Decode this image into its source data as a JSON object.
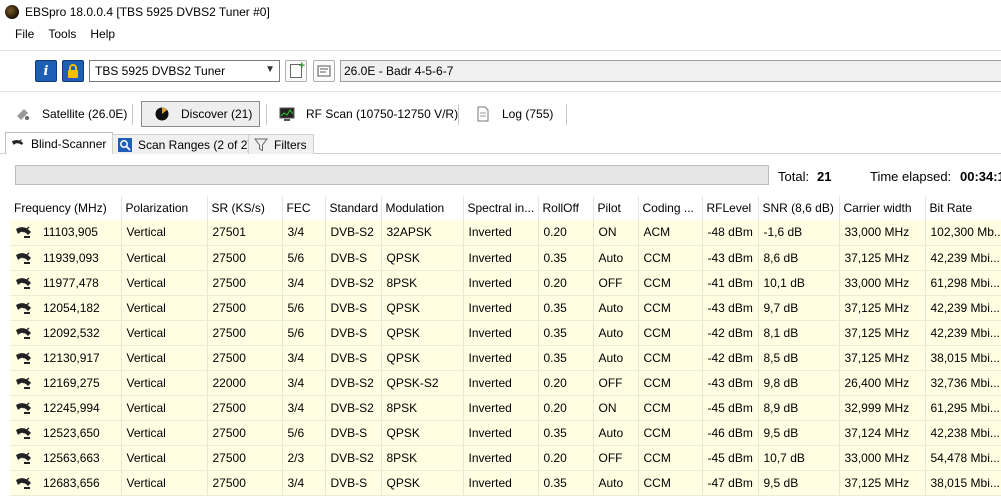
{
  "window": {
    "title": "EBSpro 18.0.0.4 [TBS 5925 DVBS2 Tuner #0]"
  },
  "menu": [
    "File",
    "Tools",
    "Help"
  ],
  "toolbar": {
    "info_icon": "info-icon",
    "lock_icon": "lock-icon",
    "tuner": "TBS 5925 DVBS2 Tuner",
    "satellite": "26.0E - Badr 4-5-6-7"
  },
  "main_tabs": [
    {
      "label": "Satellite (26.0E)",
      "icon": "satellite-icon"
    },
    {
      "label": "Discover (21)",
      "icon": "discover-icon"
    },
    {
      "label": "RF Scan (10750-12750 V/R)",
      "icon": "monitor-icon"
    },
    {
      "label": "Log (755)",
      "icon": "document-icon"
    }
  ],
  "sub_tabs": [
    {
      "label": "Blind-Scanner",
      "icon": "dish-icon"
    },
    {
      "label": "Scan Ranges (2 of 2)",
      "icon": "magnifier-icon"
    },
    {
      "label": "Filters",
      "icon": "filter-icon"
    }
  ],
  "status": {
    "progress": 0,
    "total_label": "Total:",
    "total_value": "21",
    "elapsed_label": "Time elapsed:",
    "elapsed_value": "00:34:1"
  },
  "colors": {
    "row_bg": "#fffde2",
    "accent": "#1e5fb4"
  },
  "table": {
    "columns": [
      "Frequency (MHz)",
      "Polarization",
      "SR (KS/s)",
      "FEC",
      "Standard",
      "Modulation",
      "Spectral in...",
      "RollOff",
      "Pilot",
      "Coding ...",
      "RFLevel",
      "SNR (8,6 dB)",
      "Carrier width",
      "Bit Rate"
    ],
    "rows": [
      [
        "11103,905",
        "Vertical",
        "27501",
        "3/4",
        "DVB-S2",
        "32APSK",
        "Inverted",
        "0.20",
        "ON",
        "ACM",
        "-48 dBm",
        "-1,6 dB",
        "33,000 MHz",
        "102,300 Mb..."
      ],
      [
        "11939,093",
        "Vertical",
        "27500",
        "5/6",
        "DVB-S",
        "QPSK",
        "Inverted",
        "0.35",
        "Auto",
        "CCM",
        "-43 dBm",
        "8,6 dB",
        "37,125 MHz",
        "42,239 Mbi..."
      ],
      [
        "11977,478",
        "Vertical",
        "27500",
        "3/4",
        "DVB-S2",
        "8PSK",
        "Inverted",
        "0.20",
        "OFF",
        "CCM",
        "-41 dBm",
        "10,1 dB",
        "33,000 MHz",
        "61,298 Mbi..."
      ],
      [
        "12054,182",
        "Vertical",
        "27500",
        "5/6",
        "DVB-S",
        "QPSK",
        "Inverted",
        "0.35",
        "Auto",
        "CCM",
        "-43 dBm",
        "9,7 dB",
        "37,125 MHz",
        "42,239 Mbi..."
      ],
      [
        "12092,532",
        "Vertical",
        "27500",
        "5/6",
        "DVB-S",
        "QPSK",
        "Inverted",
        "0.35",
        "Auto",
        "CCM",
        "-42 dBm",
        "8,1 dB",
        "37,125 MHz",
        "42,239 Mbi..."
      ],
      [
        "12130,917",
        "Vertical",
        "27500",
        "3/4",
        "DVB-S",
        "QPSK",
        "Inverted",
        "0.35",
        "Auto",
        "CCM",
        "-42 dBm",
        "8,5 dB",
        "37,125 MHz",
        "38,015 Mbi..."
      ],
      [
        "12169,275",
        "Vertical",
        "22000",
        "3/4",
        "DVB-S2",
        "QPSK-S2",
        "Inverted",
        "0.20",
        "OFF",
        "CCM",
        "-43 dBm",
        "9,8 dB",
        "26,400 MHz",
        "32,736 Mbi..."
      ],
      [
        "12245,994",
        "Vertical",
        "27500",
        "3/4",
        "DVB-S2",
        "8PSK",
        "Inverted",
        "0.20",
        "ON",
        "CCM",
        "-45 dBm",
        "8,9 dB",
        "32,999 MHz",
        "61,295 Mbi..."
      ],
      [
        "12523,650",
        "Vertical",
        "27500",
        "5/6",
        "DVB-S",
        "QPSK",
        "Inverted",
        "0.35",
        "Auto",
        "CCM",
        "-46 dBm",
        "9,5 dB",
        "37,124 MHz",
        "42,238 Mbi..."
      ],
      [
        "12563,663",
        "Vertical",
        "27500",
        "2/3",
        "DVB-S2",
        "8PSK",
        "Inverted",
        "0.20",
        "OFF",
        "CCM",
        "-45 dBm",
        "10,7 dB",
        "33,000 MHz",
        "54,478 Mbi..."
      ],
      [
        "12683,656",
        "Vertical",
        "27500",
        "3/4",
        "DVB-S",
        "QPSK",
        "Inverted",
        "0.35",
        "Auto",
        "CCM",
        "-47 dBm",
        "9,5 dB",
        "37,125 MHz",
        "38,015 Mbi..."
      ]
    ]
  }
}
